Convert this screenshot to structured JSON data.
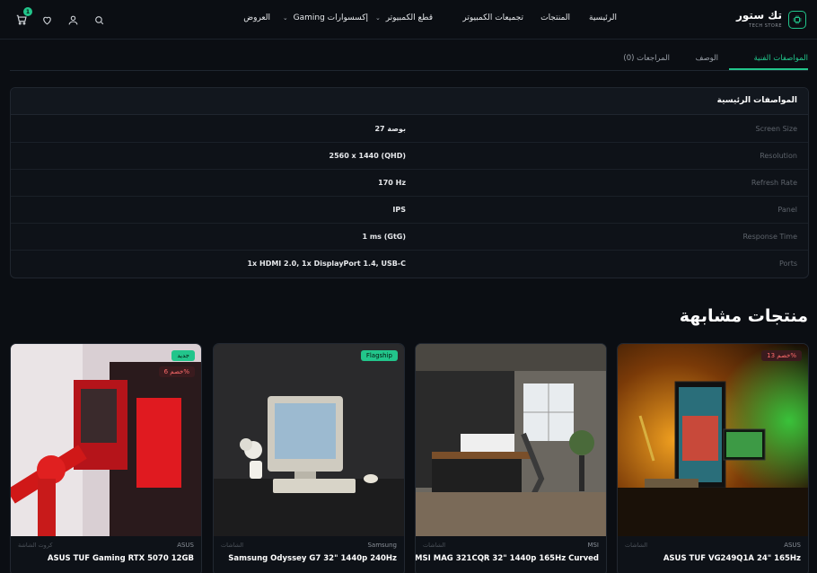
{
  "header": {
    "logo_title": "تك ستور",
    "logo_subtitle": "TECH STORE",
    "cart_count": "1",
    "nav": [
      {
        "label": "الرئيسية"
      },
      {
        "label": "المنتجات"
      },
      {
        "label": "تجميعات الكمبيوتر"
      },
      {
        "label": "قطع الكمبيوتر"
      },
      {
        "label": "إكسسوارات Gaming"
      },
      {
        "label": "العروض"
      }
    ]
  },
  "tabs": [
    {
      "label": "المواصفات الفنية",
      "active": true
    },
    {
      "label": "الوصف",
      "active": false
    },
    {
      "label": "المراجعات (0)",
      "active": false
    }
  ],
  "specs": {
    "heading": "المواصفات الرئيسية",
    "rows": [
      {
        "key": "Screen Size",
        "value": "27 بوصة"
      },
      {
        "key": "Resolution",
        "value": "2560 x 1440 (QHD)"
      },
      {
        "key": "Refresh Rate",
        "value": "170 Hz"
      },
      {
        "key": "Panel",
        "value": "IPS"
      },
      {
        "key": "Response Time",
        "value": "1 ms (GtG)"
      },
      {
        "key": "Ports",
        "value": "1x HDMI 2.0, 1x DisplayPort 1.4, USB-C"
      }
    ]
  },
  "related": {
    "title": "منتجات مشابهة",
    "cards": [
      {
        "brand": "ASUS",
        "category": "الشاشات",
        "name": "ASUS TUF VG249Q1A 24\" 165Hz",
        "badge": "خصم 13%",
        "badge2": ""
      },
      {
        "brand": "MSI",
        "category": "الشاشات",
        "name": "MSI MAG 321CQR 32\" 1440p 165Hz Curved",
        "badge": "",
        "badge2": ""
      },
      {
        "brand": "Samsung",
        "category": "الشاشات",
        "name": "Samsung Odyssey G7 32\" 1440p 240Hz",
        "badge": "Flagship",
        "badge2": ""
      },
      {
        "brand": "ASUS",
        "category": "كروت الشاشة",
        "name": "ASUS TUF Gaming RTX 5070 12GB",
        "badge": "جديد",
        "badge2": "خصم 6%"
      }
    ]
  },
  "colors": {
    "accent": "#22c58b",
    "background": "#0b0e13",
    "discount": "#ff6b6b"
  }
}
